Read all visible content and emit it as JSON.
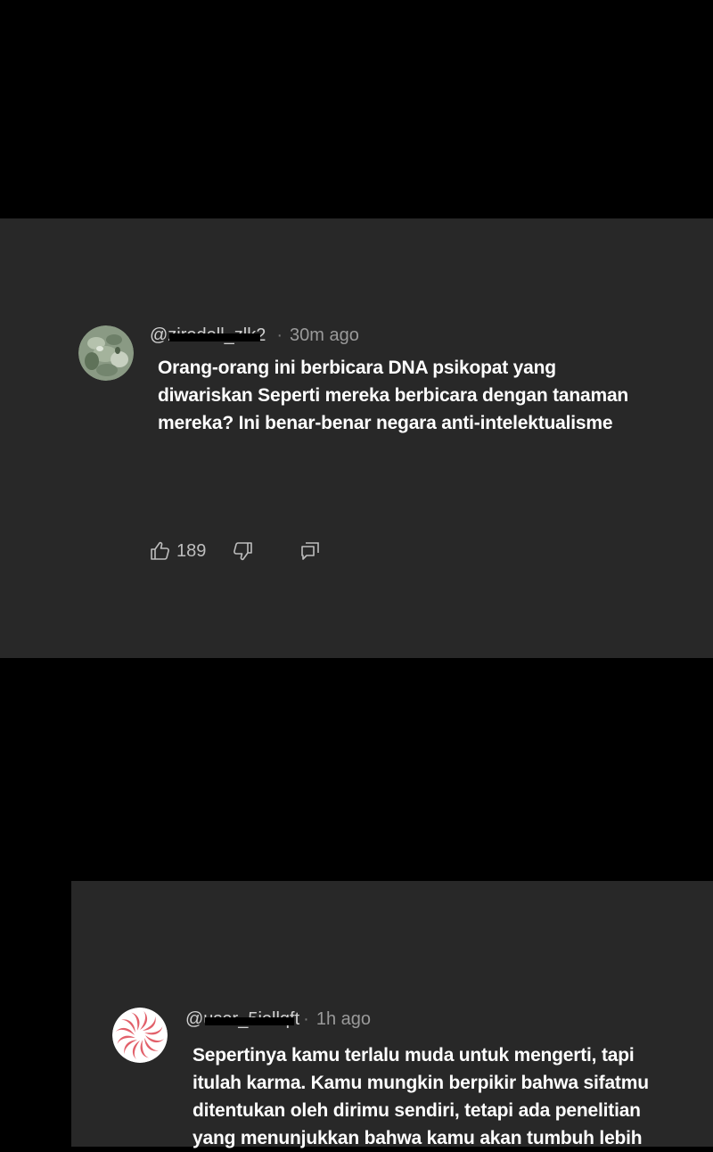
{
  "comments": [
    {
      "handle": "@ziredell_zlk2",
      "time": "30m ago",
      "text": "Orang-orang ini berbicara DNA psikopat yang\ndiwariskan Seperti mereka berbicara dengan tanaman\nmereka? Ini benar-benar negara anti-intelektualisme",
      "likes": "189",
      "avatar_icon": "plant-photo-avatar"
    },
    {
      "handle": "@user_5iollqft",
      "time": "1h ago",
      "text": "Sepertinya kamu terlalu muda untuk mengerti, tapi\nitulah karma. Kamu mungkin berpikir bahwa sifatmu\nditentukan oleh dirimu sendiri, tetapi ada penelitian\nyang menunjukkan bahwa kamu akan tumbuh lebih",
      "avatar_icon": "pinwheel-avatar"
    }
  ],
  "colors": {
    "background": "#000000",
    "card": "#282828",
    "text": "#ffffff",
    "meta": "#9a9a9a"
  }
}
